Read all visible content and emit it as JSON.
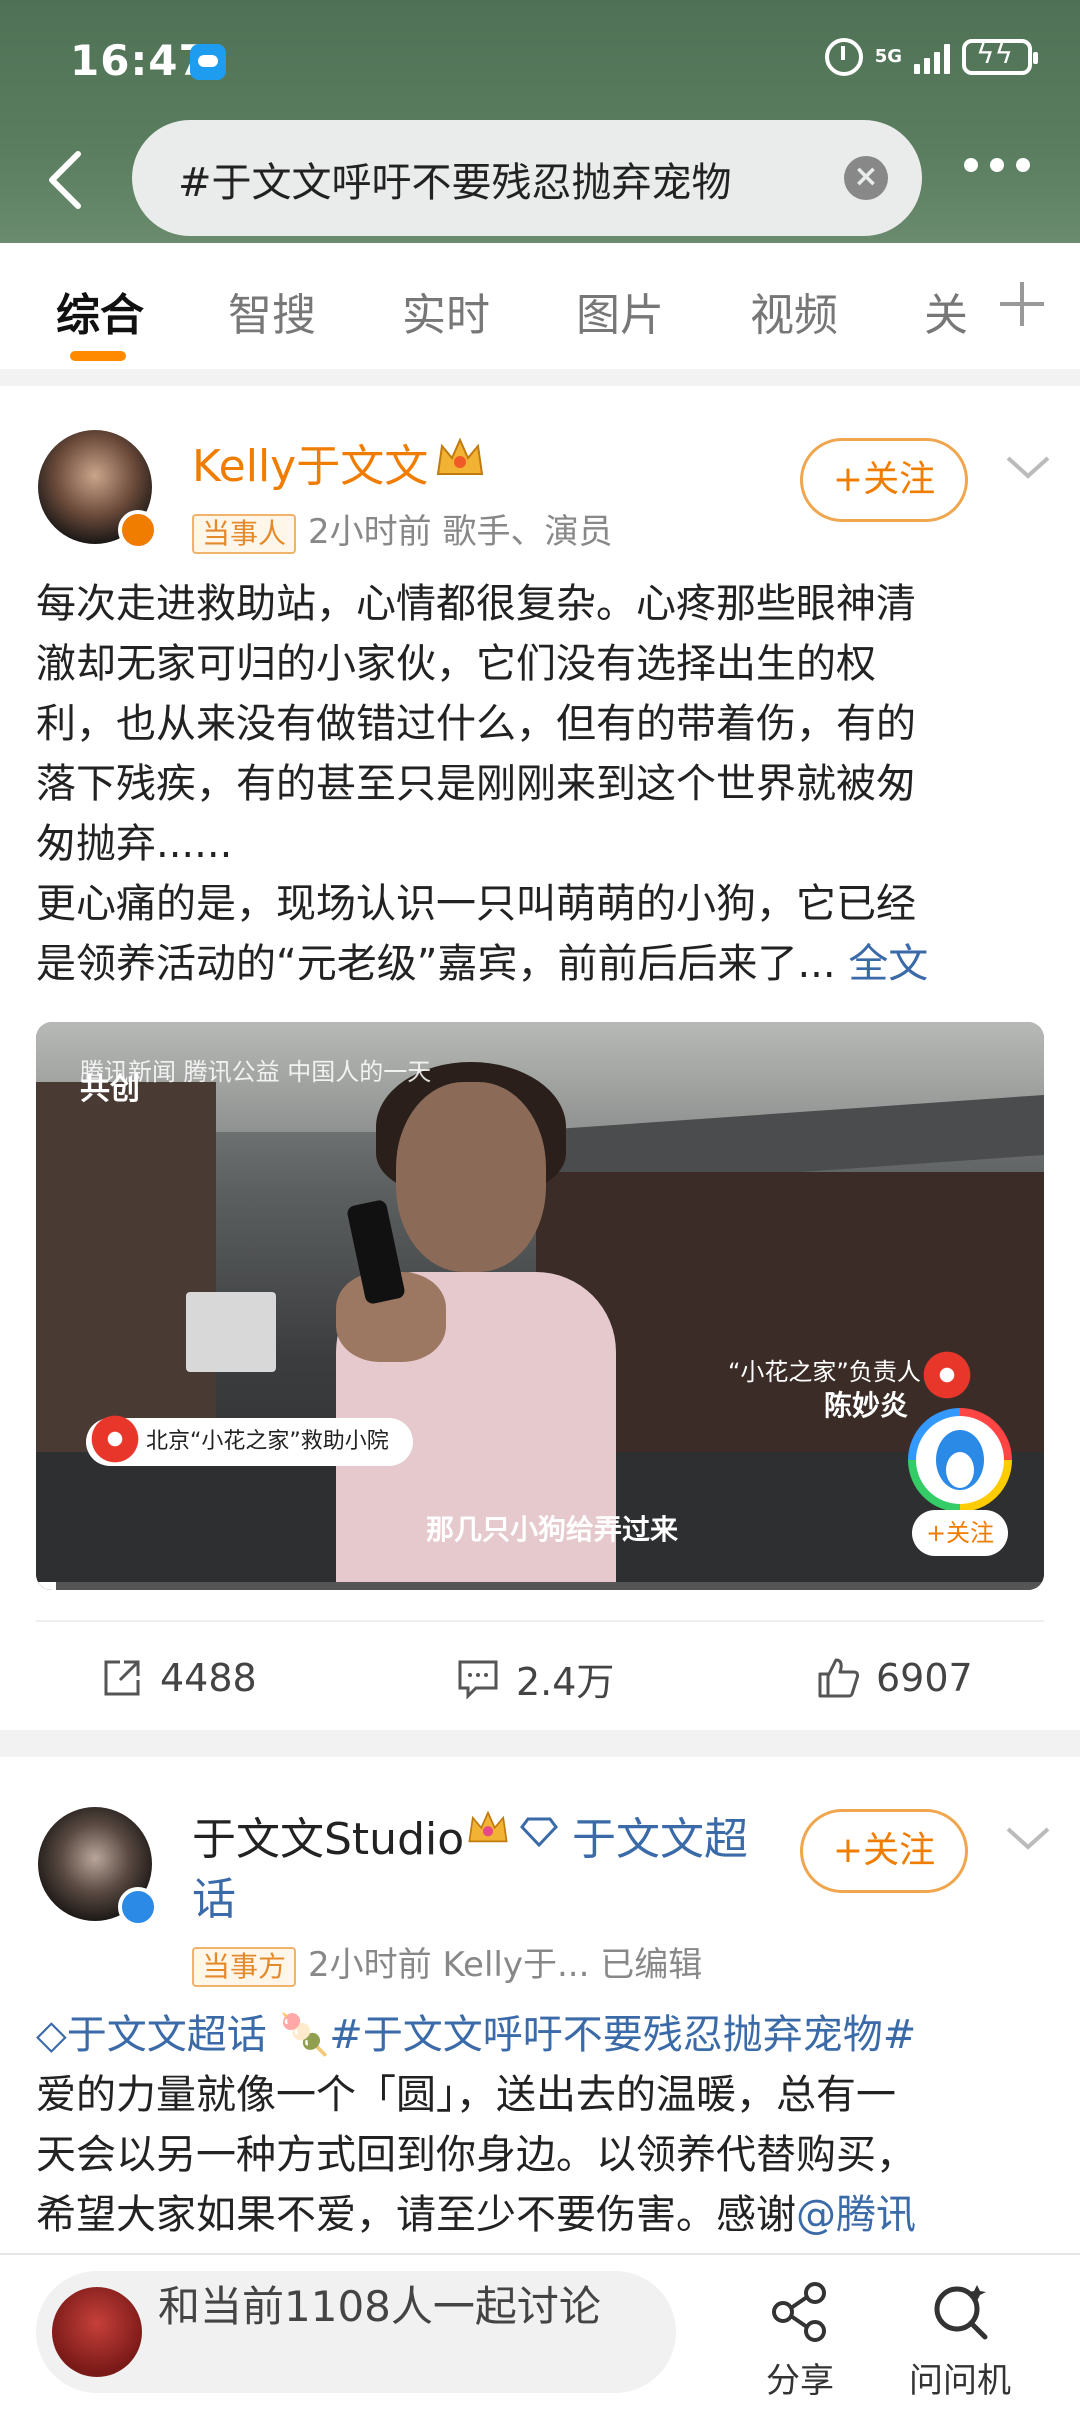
{
  "status_bar": {
    "time": "16:47",
    "network": "5G"
  },
  "search": {
    "query": "#于文文呼吁不要残忍抛弃宠物",
    "query_faded": "#"
  },
  "tabs": [
    "综合",
    "智搜",
    "实时",
    "图片",
    "视频",
    "关"
  ],
  "post1": {
    "author": "Kelly于文文",
    "tag": "当事人",
    "meta": "2小时前  歌手、演员",
    "follow": "+关注",
    "text_lines": [
      "每次走进救助站，心情都很复杂。心疼那些眼神清",
      "澈却无家可归的小家伙，它们没有选择出生的权",
      "利，也从来没有做错过什么，但有的带着伤，有的",
      "落下残疾，有的甚至只是刚刚来到这个世界就被匆",
      "匆抛弃......",
      "更心痛的是，现场认识一只叫萌萌的小狗，它已经"
    ],
    "last_line": "是领养活动的“元老级”嘉宾，前前后后来了...",
    "full_text_link": "全文",
    "video": {
      "watermark": "腾讯新闻  腾讯公益  中国人的一天",
      "cocreate": "共创",
      "location": "北京“小花之家”救助小院",
      "credit_role": "“小花之家”负责人",
      "credit_name": "陈妙炎",
      "subtitle": "那几只小狗给弄过来",
      "follow": "+关注",
      "progress": 0.02
    },
    "actions": {
      "share": "4488",
      "comment": "2.4万",
      "like": "6907"
    }
  },
  "post2": {
    "author": "于文文Studio",
    "supertopic_line1": "于文文超",
    "supertopic_line2": "话",
    "tag": "当事方",
    "meta": "2小时前  Kelly于...  已编辑",
    "follow": "+关注",
    "topic_link": "于文文超话",
    "hashtag": "#于文文呼吁不要残忍抛弃宠物#",
    "text_lines": [
      "爱的力量就像一个「圆」，送出去的温暖，总有一",
      "天会以另一种方式回到你身边。以领养代替购买，"
    ],
    "last_line_prefix": "希望大家如果不爱，请至少不要伤害。感谢",
    "mention": "@腾讯"
  },
  "bottom": {
    "discuss": "和当前1108人一起讨论",
    "share": "分享",
    "ask": "问问机"
  },
  "colors": {
    "accent": "#ff8a00",
    "link": "#3a6aa8",
    "header": "#4f7256"
  }
}
